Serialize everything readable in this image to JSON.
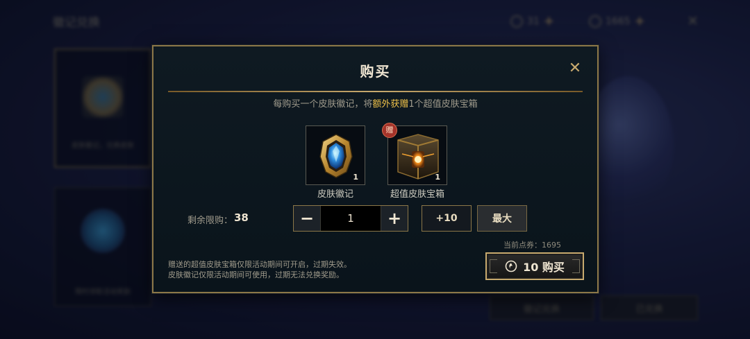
{
  "background": {
    "title": "徽记兑换",
    "currency_a": "31",
    "currency_b": "1665",
    "card_caption_a": "皮肤徽记，兑换皮肤",
    "card_caption_b": "限时领取活动奖励",
    "btn_left": "徽记兑换",
    "btn_right": "已兑换"
  },
  "dialog": {
    "title": "购买",
    "notice_prefix": "每购买一个皮肤徽记，将",
    "notice_highlight": "额外获赠",
    "notice_suffix": "1个超值皮肤宝箱",
    "items": [
      {
        "label": "皮肤徽记",
        "qty": "1",
        "icon": "skin-emblem-icon"
      },
      {
        "label": "超值皮肤宝箱",
        "qty": "1",
        "icon": "skin-chest-icon",
        "badge": "赠"
      }
    ],
    "limit_label": "剩余限购：",
    "limit_value": "38",
    "quantity": "1",
    "minus_label": "−",
    "plus_label": "+",
    "plus_ten_label": "+10",
    "max_label": "最大",
    "balance_text": "当前点券：1695",
    "footnote_line1": "赠送的超值皮肤宝箱仅限活动期间可开启，过期失效。",
    "footnote_line2": "皮肤徽记仅限活动期间可使用，过期无法兑换奖励。",
    "buy_label": "10 购买",
    "close_icon": "close-icon",
    "accent_color": "#c8aa6e",
    "highlight_color": "#f0c24a"
  }
}
